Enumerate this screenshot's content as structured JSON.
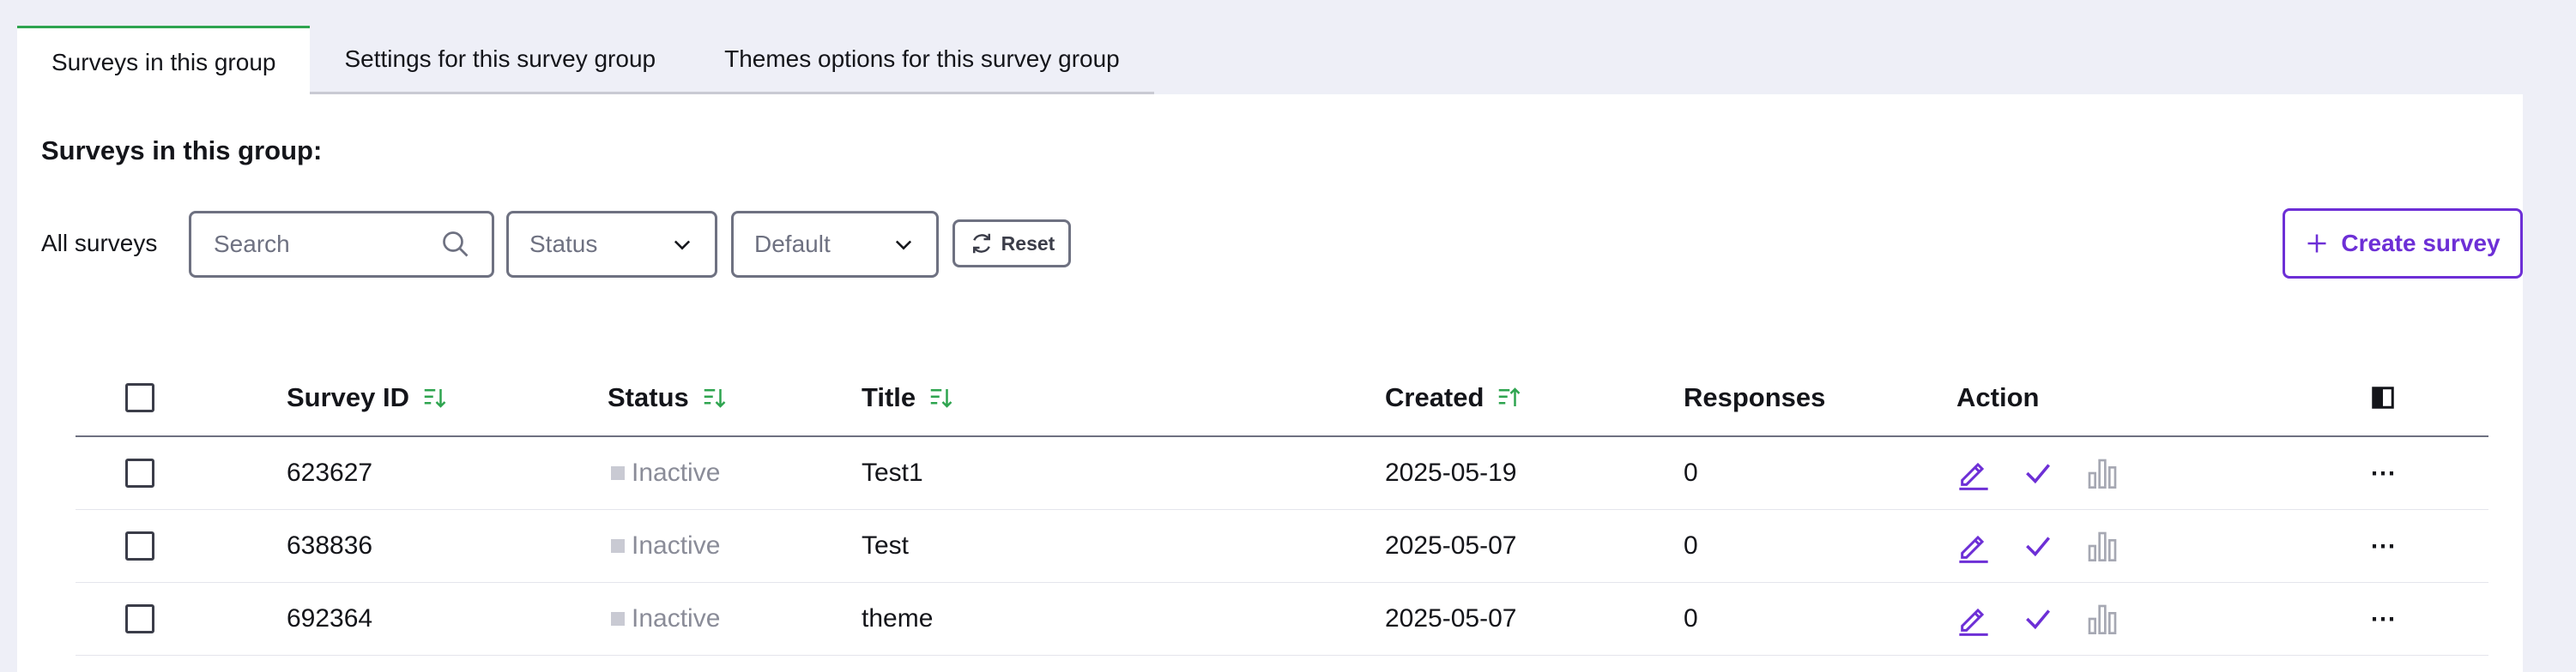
{
  "tabs": [
    {
      "label": "Surveys in this group",
      "active": true
    },
    {
      "label": "Settings for this survey group",
      "active": false
    },
    {
      "label": "Themes options for this survey group",
      "active": false
    }
  ],
  "section_title": "Surveys in this group:",
  "filters": {
    "label": "All surveys",
    "search_placeholder": "Search",
    "status_value": "Status",
    "sort_value": "Default",
    "reset_label": "Reset"
  },
  "create_button": "Create survey",
  "columns": [
    "Survey ID",
    "Status",
    "Title",
    "Created",
    "Responses",
    "Action"
  ],
  "rows": [
    {
      "id": "623627",
      "status": "Inactive",
      "title": "Test1",
      "created": "2025-05-19",
      "responses": "0"
    },
    {
      "id": "638836",
      "status": "Inactive",
      "title": "Test",
      "created": "2025-05-07",
      "responses": "0"
    },
    {
      "id": "692364",
      "status": "Inactive",
      "title": "theme",
      "created": "2025-05-07",
      "responses": "0"
    }
  ],
  "colors": {
    "accent": "#6d2fd6",
    "sort_icon": "#2ea44f",
    "active_tab_border": "#2ea44f",
    "inactive_status": "#c9cad3"
  },
  "icons": {
    "search": "search-icon",
    "dropdown": "chevron-down-icon",
    "reset": "refresh-icon",
    "create": "plus-icon",
    "sort": "sort-icon",
    "edit": "pencil-icon",
    "activate": "check-icon",
    "stats": "bar-chart-icon",
    "more": "more-icon",
    "columns": "column-toggle-icon"
  }
}
